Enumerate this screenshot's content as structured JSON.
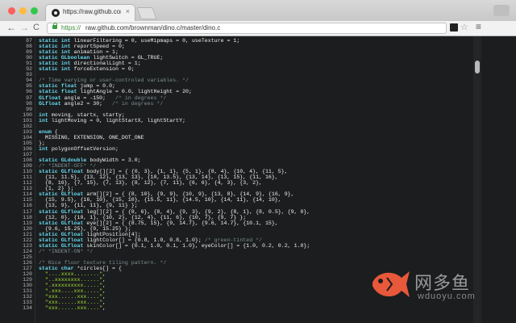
{
  "browser": {
    "tab_title": "https://raw.github.com/brownman/dino.c",
    "tab_close": "×",
    "url_scheme": "https://",
    "url_rest": "raw.github.com/brownman/dino.c/master/dino.c",
    "back": "←",
    "forward": "→",
    "reload": "C",
    "star": "☆",
    "menu": "≡"
  },
  "code_lines": [
    {
      "n": "87",
      "t": "static int linearFiltering = 0, useMipmaps = 0, useTexture = 1;"
    },
    {
      "n": "88",
      "t": "static int reportSpeed = 0;"
    },
    {
      "n": "89",
      "t": "static int animation = 1;"
    },
    {
      "n": "90",
      "t": "static GLboolean lightSwitch = GL_TRUE;"
    },
    {
      "n": "91",
      "t": "static int directionalLight = 1;"
    },
    {
      "n": "92",
      "t": "static int forceExtension = 0;"
    },
    {
      "n": "93",
      "t": ""
    },
    {
      "n": "94",
      "t": "/* Time varying or user-controled variables. */"
    },
    {
      "n": "95",
      "t": "static float jump = 0.0;"
    },
    {
      "n": "96",
      "t": "static float lightAngle = 0.0, lightHeight = 20;"
    },
    {
      "n": "97",
      "t": "GLfloat angle = -150;   /* in degrees */"
    },
    {
      "n": "98",
      "t": "GLfloat angle2 = 30;   /* in degrees */"
    },
    {
      "n": "99",
      "t": ""
    },
    {
      "n": "100",
      "t": "int moving, startx, starty;"
    },
    {
      "n": "101",
      "t": "int lightMoving = 0, lightStartX, lightStartY;"
    },
    {
      "n": "102",
      "t": ""
    },
    {
      "n": "103",
      "t": "enum {"
    },
    {
      "n": "104",
      "t": "  MISSING, EXTENSION, ONE_DOT_ONE"
    },
    {
      "n": "105",
      "t": "};"
    },
    {
      "n": "106",
      "t": "int polygonOffsetVersion;"
    },
    {
      "n": "107",
      "t": ""
    },
    {
      "n": "108",
      "t": "static GLdouble bodyWidth = 3.0;"
    },
    {
      "n": "109",
      "t": "/* *INDENT-OFF* */"
    },
    {
      "n": "110",
      "t": "static GLfloat body[][2] = { {0, 3}, {1, 1}, {5, 1}, {8, 4}, {10, 4}, {11, 5},"
    },
    {
      "n": "111",
      "t": "  {11, 11.5}, {13, 12}, {13, 13}, {10, 13.5}, {13, 14}, {13, 15}, {11, 16},"
    },
    {
      "n": "112",
      "t": "  {8, 16}, {7, 15}, {7, 13}, {8, 12}, {7, 11}, {6, 6}, {4, 3}, {3, 2},"
    },
    {
      "n": "113",
      "t": "  {1, 2} };"
    },
    {
      "n": "114",
      "t": "static GLfloat arm[][2] = { {8, 10}, {9, 9}, {10, 9}, {13, 8}, {14, 9}, {16, 9},"
    },
    {
      "n": "115",
      "t": "  {15, 9.5}, {16, 10}, {15, 10}, {15.5, 11}, {14.5, 10}, {14, 11}, {14, 10},"
    },
    {
      "n": "116",
      "t": "  {13, 9}, {11, 11}, {9, 11} };"
    },
    {
      "n": "117",
      "t": "static GLfloat leg[][2] = { {8, 6}, {8, 4}, {9, 3}, {9, 2}, {8, 1}, {8, 0.5}, {9, 0},"
    },
    {
      "n": "118",
      "t": "  {12, 0}, {10, 1}, {10, 2}, {12, 4}, {11, 6}, {10, 7}, {9, 7} };"
    },
    {
      "n": "119",
      "t": "static GLfloat eye[][2] = { {8.75, 15}, {9, 14.7}, {9.6, 14.7}, {10.1, 15},"
    },
    {
      "n": "120",
      "t": "  {9.6, 15.25}, {9, 15.25} };"
    },
    {
      "n": "121",
      "t": "static GLfloat lightPosition[4];"
    },
    {
      "n": "122",
      "t": "static GLfloat lightColor[] = {0.8, 1.0, 0.8, 1.0}; /* green-tinted */"
    },
    {
      "n": "123",
      "t": "static GLfloat skinColor[] = {0.1, 1.0, 0.1, 1.0}, eyeColor[] = {1.0, 0.2, 0.2, 1.0};"
    },
    {
      "n": "124",
      "t": "/* *INDENT-ON* */"
    },
    {
      "n": "125",
      "t": ""
    },
    {
      "n": "126",
      "t": "/* Nice floor texture tiling pattern. */"
    },
    {
      "n": "127",
      "t": "static char *circles[] = {"
    },
    {
      "n": "128",
      "t": "  \"....xxxx........\","
    },
    {
      "n": "129",
      "t": "  \"..xxxxxxxx......\","
    },
    {
      "n": "130",
      "t": "  \".xxxxxxxxxx.....\","
    },
    {
      "n": "131",
      "t": "  \".xxx....xxx.....\","
    },
    {
      "n": "132",
      "t": "  \"xxx......xxx....\","
    },
    {
      "n": "133",
      "t": "  \"xxx......xxx....\","
    },
    {
      "n": "134",
      "t": "  \"xxx......xxx....\","
    }
  ],
  "watermark": {
    "cn": "网多鱼",
    "en": "wduoyu.com"
  },
  "colors": {
    "background": "#1b1d1e",
    "keyword": "#66d9ef",
    "comment": "#7e8e91",
    "string": "#a6e22e",
    "watermark_fish": "#e8583a"
  }
}
